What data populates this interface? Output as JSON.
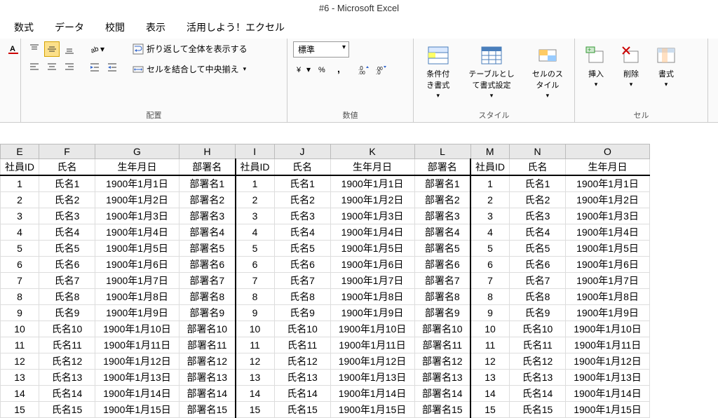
{
  "title": "#6 - Microsoft Excel",
  "menu": [
    "数式",
    "データ",
    "校閲",
    "表示",
    "活用しよう！エクセル"
  ],
  "ribbon": {
    "alignment": {
      "label": "配置",
      "wrap": "折り返して全体を表示する",
      "merge": "セルを結合して中央揃え"
    },
    "number": {
      "label": "数値",
      "format_combo": "標準"
    },
    "styles": {
      "label": "スタイル",
      "cond": "条件付き書式",
      "table": "テーブルとして書式設定",
      "cell": "セルのスタイル"
    },
    "cells": {
      "label": "セル",
      "insert": "挿入",
      "delete": "削除",
      "format": "書式"
    }
  },
  "columns": [
    "E",
    "F",
    "G",
    "H",
    "I",
    "J",
    "K",
    "L",
    "M",
    "N",
    "O"
  ],
  "headers": [
    "社員ID",
    "氏名",
    "生年月日",
    "部署名",
    "社員ID",
    "氏名",
    "生年月日",
    "部署名",
    "社員ID",
    "氏名",
    "生年月日"
  ],
  "rows": [
    [
      "1",
      "氏名1",
      "1900年1月1日",
      "部署名1",
      "1",
      "氏名1",
      "1900年1月1日",
      "部署名1",
      "1",
      "氏名1",
      "1900年1月1日"
    ],
    [
      "2",
      "氏名2",
      "1900年1月2日",
      "部署名2",
      "2",
      "氏名2",
      "1900年1月2日",
      "部署名2",
      "2",
      "氏名2",
      "1900年1月2日"
    ],
    [
      "3",
      "氏名3",
      "1900年1月3日",
      "部署名3",
      "3",
      "氏名3",
      "1900年1月3日",
      "部署名3",
      "3",
      "氏名3",
      "1900年1月3日"
    ],
    [
      "4",
      "氏名4",
      "1900年1月4日",
      "部署名4",
      "4",
      "氏名4",
      "1900年1月4日",
      "部署名4",
      "4",
      "氏名4",
      "1900年1月4日"
    ],
    [
      "5",
      "氏名5",
      "1900年1月5日",
      "部署名5",
      "5",
      "氏名5",
      "1900年1月5日",
      "部署名5",
      "5",
      "氏名5",
      "1900年1月5日"
    ],
    [
      "6",
      "氏名6",
      "1900年1月6日",
      "部署名6",
      "6",
      "氏名6",
      "1900年1月6日",
      "部署名6",
      "6",
      "氏名6",
      "1900年1月6日"
    ],
    [
      "7",
      "氏名7",
      "1900年1月7日",
      "部署名7",
      "7",
      "氏名7",
      "1900年1月7日",
      "部署名7",
      "7",
      "氏名7",
      "1900年1月7日"
    ],
    [
      "8",
      "氏名8",
      "1900年1月8日",
      "部署名8",
      "8",
      "氏名8",
      "1900年1月8日",
      "部署名8",
      "8",
      "氏名8",
      "1900年1月8日"
    ],
    [
      "9",
      "氏名9",
      "1900年1月9日",
      "部署名9",
      "9",
      "氏名9",
      "1900年1月9日",
      "部署名9",
      "9",
      "氏名9",
      "1900年1月9日"
    ],
    [
      "10",
      "氏名10",
      "1900年1月10日",
      "部署名10",
      "10",
      "氏名10",
      "1900年1月10日",
      "部署名10",
      "10",
      "氏名10",
      "1900年1月10日"
    ],
    [
      "11",
      "氏名11",
      "1900年1月11日",
      "部署名11",
      "11",
      "氏名11",
      "1900年1月11日",
      "部署名11",
      "11",
      "氏名11",
      "1900年1月11日"
    ],
    [
      "12",
      "氏名12",
      "1900年1月12日",
      "部署名12",
      "12",
      "氏名12",
      "1900年1月12日",
      "部署名12",
      "12",
      "氏名12",
      "1900年1月12日"
    ],
    [
      "13",
      "氏名13",
      "1900年1月13日",
      "部署名13",
      "13",
      "氏名13",
      "1900年1月13日",
      "部署名13",
      "13",
      "氏名13",
      "1900年1月13日"
    ],
    [
      "14",
      "氏名14",
      "1900年1月14日",
      "部署名14",
      "14",
      "氏名14",
      "1900年1月14日",
      "部署名14",
      "14",
      "氏名14",
      "1900年1月14日"
    ],
    [
      "15",
      "氏名15",
      "1900年1月15日",
      "部署名15",
      "15",
      "氏名15",
      "1900年1月15日",
      "部署名15",
      "15",
      "氏名15",
      "1900年1月15日"
    ]
  ]
}
